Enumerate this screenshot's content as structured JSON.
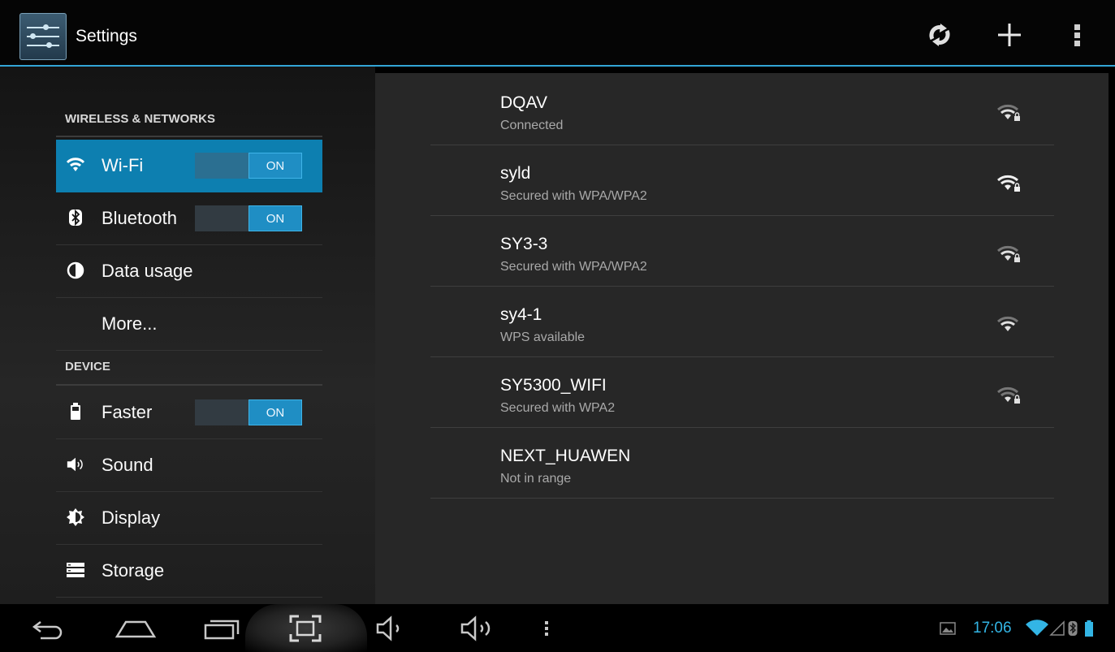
{
  "actionbar": {
    "title": "Settings",
    "icons": [
      "settings-app-icon",
      "refresh-icon",
      "add-icon",
      "overflow-menu-icon"
    ]
  },
  "sections": {
    "wireless": "WIRELESS & NETWORKS",
    "device": "DEVICE"
  },
  "items": {
    "wifi": {
      "label": "Wi-Fi",
      "toggle": "ON"
    },
    "bluetooth": {
      "label": "Bluetooth",
      "toggle": "ON"
    },
    "data_usage": {
      "label": "Data usage"
    },
    "more": {
      "label": "More..."
    },
    "faster": {
      "label": "Faster",
      "toggle": "ON"
    },
    "sound": {
      "label": "Sound"
    },
    "display": {
      "label": "Display"
    },
    "storage": {
      "label": "Storage"
    }
  },
  "networks": [
    {
      "ssid": "DQAV",
      "status": "Connected",
      "signal_icon": "wifi-lock-signal-icon"
    },
    {
      "ssid": "syld",
      "status": "Secured with WPA/WPA2",
      "signal_icon": "wifi-lock-signal-icon"
    },
    {
      "ssid": "SY3-3",
      "status": "Secured with WPA/WPA2",
      "signal_icon": "wifi-lock-signal-icon"
    },
    {
      "ssid": "sy4-1",
      "status": "WPS available",
      "signal_icon": "wifi-signal-icon"
    },
    {
      "ssid": "SY5300_WIFI",
      "status": "Secured with WPA2",
      "signal_icon": "wifi-lock-signal-icon"
    },
    {
      "ssid": "NEXT_HUAWEN",
      "status": "Not in range",
      "signal_icon": ""
    }
  ],
  "statusbar": {
    "time": "17:06",
    "icons": [
      "gallery-notification-icon",
      "wifi-status-icon",
      "cell-signal-icon",
      "bluetooth-status-icon",
      "battery-icon"
    ]
  },
  "colors": {
    "accent": "#33b5e5",
    "selected_row": "#0d7fb0"
  }
}
